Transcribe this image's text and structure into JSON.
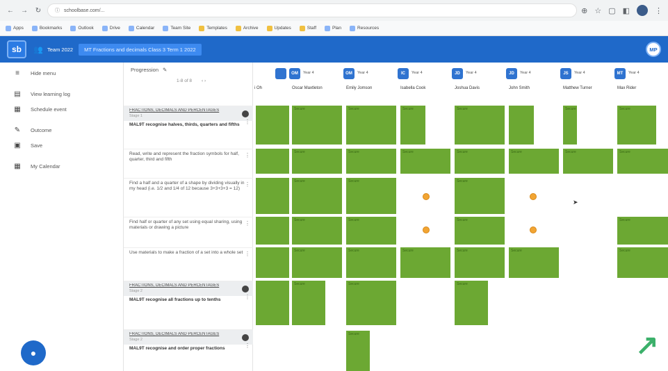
{
  "browser": {
    "url": "schoolbase.com/...",
    "bookmarks": [
      "Apps",
      "Bookmarks",
      "Outlook",
      "Drive",
      "Calendar",
      "Team Site",
      "Templates",
      "Archive",
      "Updates",
      "Staff",
      "Plan",
      "Resources"
    ]
  },
  "header": {
    "logo_text": "sb",
    "team_label": "Team 2022",
    "class_pill": "MT Fractions and decimals Class 3 Term 1 2022",
    "user_initials": "MP"
  },
  "sidebar": {
    "items": [
      {
        "icon": "menu-icon",
        "label": "Hide menu"
      },
      {
        "icon": "book-icon",
        "label": "View learning log"
      },
      {
        "icon": "calendar-icon",
        "label": "Schedule event"
      },
      {
        "icon": "pencil-icon",
        "label": "Outcome"
      },
      {
        "icon": "save-icon",
        "label": "Save"
      },
      {
        "icon": "calendar-icon",
        "label": "My Calendar"
      }
    ]
  },
  "progression": {
    "label": "Progression",
    "sub_left": "1-8 of 8",
    "sub_right": "‹ ›"
  },
  "outcomes": [
    {
      "strand": "FRACTIONS, DECIMALS AND PERCENTAGES",
      "sub": "Stage 1",
      "title": "MAL9T recognise halves, thirds, quarters and fifths",
      "grey": true
    },
    {
      "strand": "",
      "sub": "",
      "title": "",
      "text": "Read, write and represent the fraction symbols for half, quarter, third and fifth",
      "grey": false
    },
    {
      "strand": "",
      "sub": "",
      "title": "",
      "text": "Find a half and a quarter of a shape by dividing visually in my head (i.e. 1/2 and 1/4 of 12 because 3+3+3+3 = 12)",
      "grey": false
    },
    {
      "strand": "",
      "sub": "",
      "title": "",
      "text": "Find half or quarter of any set using equal sharing, using materials or drawing a picture",
      "grey": false
    },
    {
      "strand": "",
      "sub": "",
      "title": "",
      "text": "Use materials to make a fraction of a set into a whole set",
      "grey": false
    },
    {
      "strand": "FRACTIONS, DECIMALS AND PERCENTAGES",
      "sub": "Stage 2",
      "title": "MAL9T recognise all fractions up to tenths",
      "grey": true
    },
    {
      "strand": "FRACTIONS, DECIMALS AND PERCENTAGES",
      "sub": "Stage 2",
      "title": "MAL9T recognise and order proper fractions",
      "grey": true
    }
  ],
  "students": [
    {
      "initials": "",
      "year": "",
      "name": "i Oh"
    },
    {
      "initials": "OM",
      "year": "Year 4",
      "name": "Oscar Maxtleton"
    },
    {
      "initials": "OM",
      "year": "Year 4",
      "name": "Emily Jomson"
    },
    {
      "initials": "IC",
      "year": "Year 4",
      "name": "Isabella Cook"
    },
    {
      "initials": "JD",
      "year": "Year 4",
      "name": "Joshua Davis"
    },
    {
      "initials": "JD",
      "year": "Year 4",
      "name": "John Smith"
    },
    {
      "initials": "JS",
      "year": "Year 4",
      "name": "Matthew Turner"
    },
    {
      "initials": "MT",
      "year": "Year 4",
      "name": "Max Rider"
    }
  ],
  "cell_label": "Secure"
}
